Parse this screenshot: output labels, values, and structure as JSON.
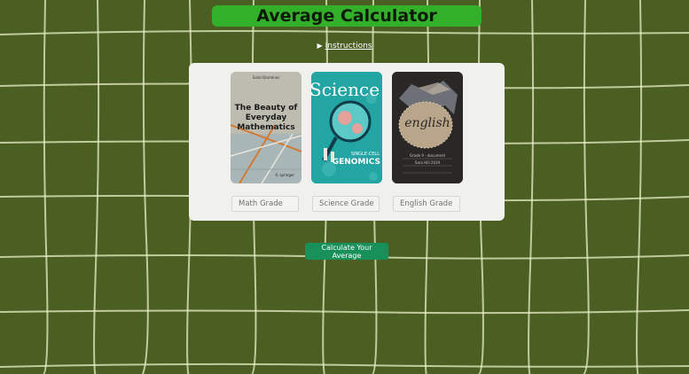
{
  "header": {
    "title": "Average Calculator"
  },
  "instructions": {
    "toggle": "▶",
    "label": "Instructions"
  },
  "cards": {
    "math": {
      "small": "Saint-Doménes",
      "title_l1": "The Beauty of",
      "title_l2": "Everyday",
      "title_l3": "Mathematics",
      "footer": "© springer"
    },
    "science": {
      "title": "Science",
      "sub_l1": "SINGLE-CELL",
      "sub_l2": "GENOMICS"
    },
    "english": {
      "title": "english",
      "note_l1": "Grade 9 - document",
      "note_l2": "Sara Hill 2019"
    }
  },
  "inputs": {
    "math_placeholder": "Math Grade",
    "science_placeholder": "Science Grade",
    "english_placeholder": "English Grade"
  },
  "actions": {
    "calculate_label": "Calculate Your Average"
  },
  "colors": {
    "background": "#4b5f23",
    "grid_lines": "#e6f0c8",
    "title_bar": "#33b02a",
    "button": "#17905a"
  }
}
